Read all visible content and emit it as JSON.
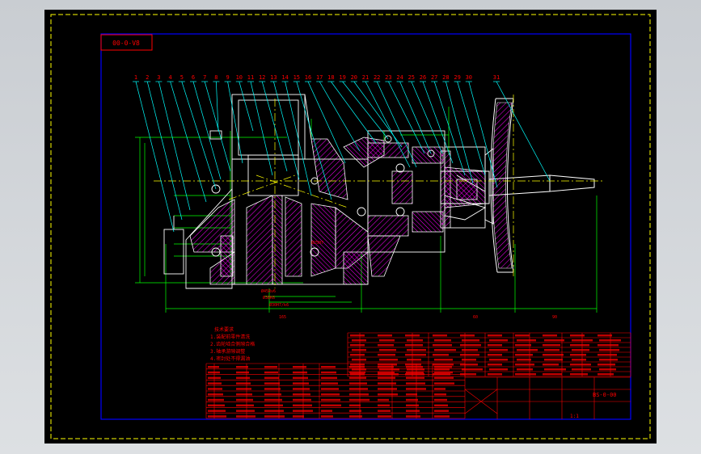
{
  "drawing": {
    "code_box": "00-0-V8",
    "colors": {
      "background": "#000000",
      "outer_border": "#ffff00",
      "inner_border": "#0000ff",
      "hatch": "#ff00ff",
      "outline": "#ffffff",
      "dimension": "#00ff00",
      "leader": "#00ffff",
      "center_line": "#ffff00",
      "annotation": "#ff0000"
    },
    "part_numbers": [
      "1",
      "2",
      "3",
      "4",
      "5",
      "6",
      "7",
      "8",
      "9",
      "10",
      "11",
      "12",
      "13",
      "14",
      "15",
      "16",
      "17",
      "18",
      "19",
      "20",
      "21",
      "22",
      "23",
      "24",
      "25",
      "26",
      "27",
      "28",
      "29",
      "30",
      "31"
    ],
    "dimensions": {
      "bottom_left": "165",
      "bottom_mid": "60",
      "bottom_right": "90",
      "dim_a": "Ø45Rv6",
      "dim_b": "Ø38K6",
      "dim_c": "Ø30H7/k6",
      "dim_d": "Ø25H7"
    },
    "tech_notes": [
      "技术要求",
      "1.装配前零件清洗",
      "2.齿轮啮合侧隙合格",
      "3.轴承游隙调整",
      "4.密封处不得漏油"
    ],
    "title_block": {
      "drawing_no": "BS-0-00",
      "scale": "1:1"
    }
  }
}
